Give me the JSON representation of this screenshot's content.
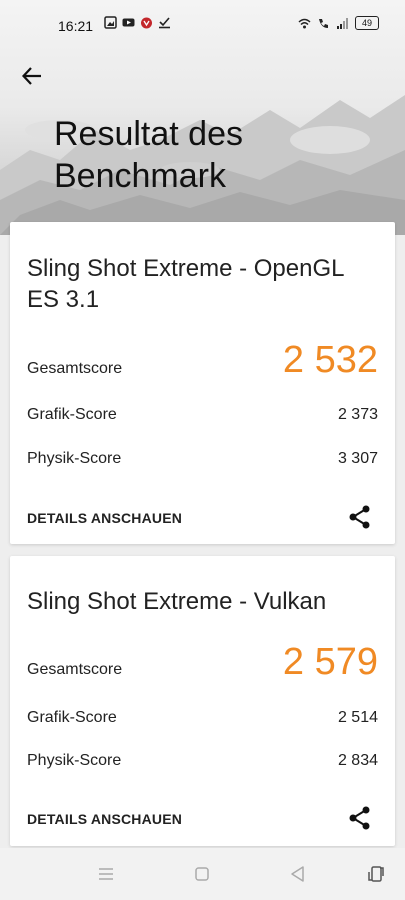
{
  "status_bar": {
    "time": "16:21",
    "battery": "49"
  },
  "page": {
    "title_line1": "Resultat des",
    "title_line2": "Benchmark"
  },
  "results": [
    {
      "title": "Sling Shot Extreme - OpenGL ES 3.1",
      "total_label": "Gesamtscore",
      "total_value": "2 532",
      "graphics_label": "Grafik-Score",
      "graphics_value": "2 373",
      "physics_label": "Physik-Score",
      "physics_value": "3 307",
      "details_label": "DETAILS ANSCHAUEN"
    },
    {
      "title": "Sling Shot Extreme - Vulkan",
      "total_label": "Gesamtscore",
      "total_value": "2 579",
      "graphics_label": "Grafik-Score",
      "graphics_value": "2 514",
      "physics_label": "Physik-Score",
      "physics_value": "2 834",
      "details_label": "DETAILS ANSCHAUEN"
    }
  ],
  "colors": {
    "accent": "#f08a24"
  }
}
